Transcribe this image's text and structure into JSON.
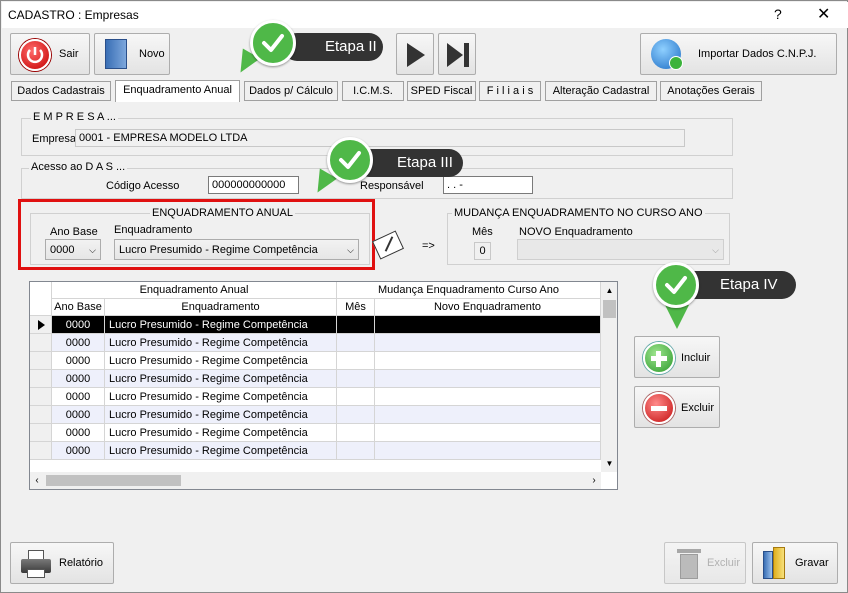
{
  "window": {
    "title": "CADASTRO : Empresas",
    "help": "?",
    "close": "✕"
  },
  "toolbar": {
    "sair": "Sair",
    "novo": "Novo",
    "importar": "Importar Dados C.N.P.J."
  },
  "tabs": [
    {
      "label": "Dados Cadastrais"
    },
    {
      "label": "Enquadramento Anual"
    },
    {
      "label": "Dados p/ Cálculo"
    },
    {
      "label": "I.C.M.S."
    },
    {
      "label": "SPED Fiscal"
    },
    {
      "label": "F i l i a i s"
    },
    {
      "label": "Alteração Cadastral"
    },
    {
      "label": "Anotações Gerais"
    }
  ],
  "empresa": {
    "group": "E M P R E S A ...",
    "label": "Empresa",
    "value": "0001 - EMPRESA MODELO LTDA"
  },
  "das": {
    "group": "Acesso ao  D A S ...",
    "codigo_label": "Código Acesso",
    "codigo_value": "000000000000",
    "responsavel_label": "Responsável",
    "responsavel_value": ". .  -"
  },
  "enquadramento": {
    "group": "ENQUADRAMENTO   ANUAL",
    "ano_label": "Ano Base",
    "ano_value": "0000",
    "enq_label": "Enquadramento",
    "enq_value": "Lucro Presumido - Regime Competência",
    "arrow": "=>"
  },
  "mudanca": {
    "group": "MUDANÇA  ENQUADRAMENTO  NO  CURSO  ANO",
    "mes_label": "Mês",
    "mes_value": "0",
    "novo_label": "NOVO  Enquadramento"
  },
  "grid": {
    "band1": "Enquadramento Anual",
    "band2": "Mudança Enquadramento Curso Ano",
    "columns": [
      "Ano Base",
      "Enquadramento",
      "Mês",
      "Novo Enquadramento"
    ],
    "rows": [
      {
        "ano": "0000",
        "enq": "Lucro Presumido - Regime Competência"
      },
      {
        "ano": "0000",
        "enq": "Lucro Presumido - Regime Competência"
      },
      {
        "ano": "0000",
        "enq": "Lucro Presumido - Regime Competência"
      },
      {
        "ano": "0000",
        "enq": "Lucro Presumido - Regime Competência"
      },
      {
        "ano": "0000",
        "enq": "Lucro Presumido - Regime Competência"
      },
      {
        "ano": "0000",
        "enq": "Lucro Presumido - Regime Competência"
      },
      {
        "ano": "0000",
        "enq": "Lucro Presumido - Regime Competência"
      },
      {
        "ano": "0000",
        "enq": "Lucro Presumido - Regime Competência"
      }
    ]
  },
  "actions": {
    "incluir": "Incluir",
    "excluir": "Excluir"
  },
  "bottom": {
    "relatorio": "Relatório",
    "excluir": "Excluir",
    "gravar": "Gravar"
  },
  "callouts": {
    "etapa2": "Etapa II",
    "etapa3": "Etapa III",
    "etapa4": "Etapa IV"
  },
  "colors": {
    "highlight": "#e01010",
    "callout_green": "#4fb848",
    "selected_row": "#000000"
  }
}
